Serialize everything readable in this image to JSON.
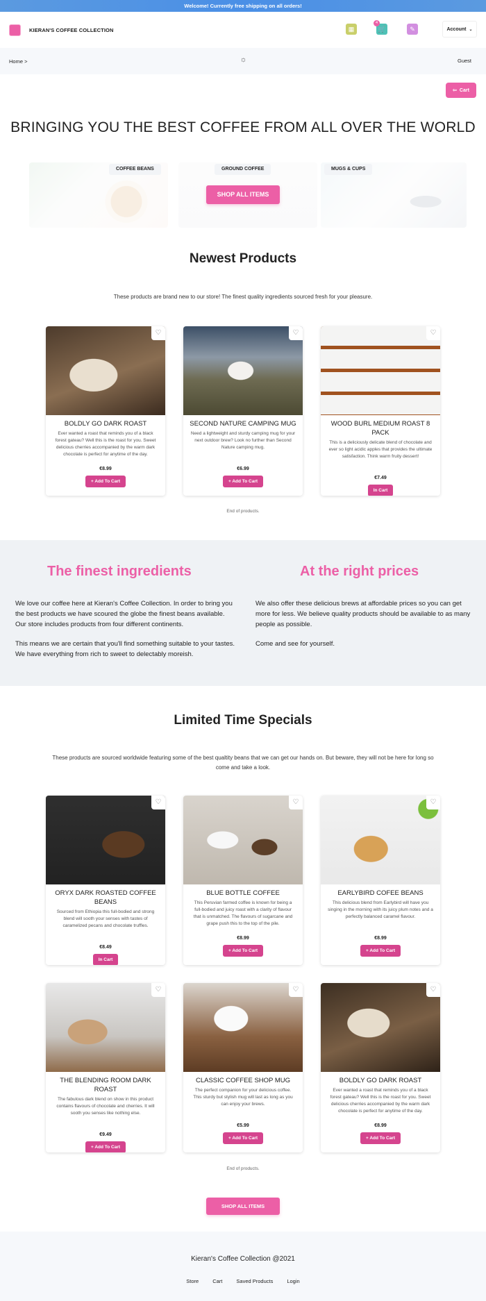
{
  "banner": {
    "text": "Welcome! Currently free shipping on all orders!"
  },
  "header": {
    "brand": "KIERAN'S COFFEE COLLECTION",
    "cart_count": "4",
    "account_label": "Account",
    "colors": {
      "accent": "#ec5fa6",
      "banner": "#4a8fe6"
    }
  },
  "crumbs": {
    "breadcrumb": "Home >",
    "user": "Guest"
  },
  "cart_button": {
    "label": "Cart"
  },
  "hero": {
    "title": "BRINGING YOU THE BEST COFFEE FROM ALL OVER THE WORLD",
    "categories": [
      "COFFEE BEANS",
      "GROUND COFFEE",
      "MUGS & CUPS"
    ],
    "shop_all": "SHOP ALL ITEMS"
  },
  "newest": {
    "title": "Newest Products",
    "subtitle": "These products are brand new to our store! The finest quality ingredients sourced fresh for your pleasure.",
    "products": [
      {
        "name": "BOLDLY GO DARK ROAST",
        "desc": "Ever wanted a roast that reminds you of a black forest gateau? Well this is the roast for you. Sweet delicious cherries accompanied by the warm dark chocolate is perfect for anytime of the day.",
        "price": "€8.99",
        "action": "+ Add To Cart"
      },
      {
        "name": "SECOND NATURE CAMPING MUG",
        "desc": "Need a lightweight and sturdy camping mug for your next outdoor brew? Look no further than Second Nature camping mug.",
        "price": "€6.99",
        "action": "+ Add To Cart"
      },
      {
        "name": "WOOD BURL MEDIUM ROAST 8 PACK",
        "desc": "This is a deliciously delicate blend of chocolate and ever so light acidic apples that provides the ultimate satisfaction. Think warm fruity dessert!",
        "price": "€7.49",
        "action": "In Cart"
      }
    ],
    "end": "End of products."
  },
  "info": {
    "left_title": "The finest ingredients",
    "left_p1": "We love our coffee here at Kieran's Coffee Collection. In order to bring you the best products we have scoured the globe the finest beans available. Our store includes products from four different continents.",
    "left_p2": "This means we are certain that you'll find something suitable to your tastes. We have everything from rich to sweet to delectably moreish.",
    "right_title": "At the right prices",
    "right_p1": "We also offer these delicious brews at affordable prices so you can get more for less. We believe quality products should be available to as many people as possible.",
    "right_p2": "Come and see for yourself."
  },
  "specials": {
    "title": "Limited Time Specials",
    "subtitle": "These products are sourced worldwide featuring some of the best qualtity beans that we can get our hands on. But beware, they will not be here for long so come and take a look.",
    "products": [
      {
        "name": "ORYX DARK ROASTED COFFEE BEANS",
        "desc": "Sourced from Ethiopia this full-bodied and strong blend will sooth your senses with tastes of caramelized pecans and chocolate truffles.",
        "price": "€8.49",
        "action": "In Cart"
      },
      {
        "name": "BLUE BOTTLE COFFEE",
        "desc": "This Peruvian farmed coffee is known for being a full-bodied and juicy roast with a clarity of flavour that is unmatched. The flavours of sugarcane and grape push this to the top of the pile.",
        "price": "€8.99",
        "action": "+ Add To Cart"
      },
      {
        "name": "EARLYBIRD COFEE BEANS",
        "desc": "This delicious blend from Earlybird will have you singing in the morning with its juicy plum notes and a perfectly balanced caramel flavour.",
        "price": "€8.99",
        "action": "+ Add To Cart"
      },
      {
        "name": "THE BLENDING ROOM DARK ROAST",
        "desc": "The fabulous dark blend on show in this product contains flavours of chocolate and cherries. It will sooth you senses like nothing else.",
        "price": "€9.49",
        "action": "+ Add To Cart"
      },
      {
        "name": "CLASSIC COFFEE SHOP MUG",
        "desc": "The perfect companion for your delicious coffee. This sturdy but stylish mug will last as long as you can enjoy your brews.",
        "price": "€5.99",
        "action": "+ Add To Cart"
      },
      {
        "name": "BOLDLY GO DARK ROAST",
        "desc": "Ever wanted a roast that reminds you of a black forest gateau? Well this is the roast for you. Sweet delicious cherries accompanied by the warm dark chocolate is perfect for anytime of the day.",
        "price": "€8.99",
        "action": "+ Add To Cart"
      }
    ],
    "end": "End of products.",
    "shop_all": "SHOP ALL ITEMS"
  },
  "footer": {
    "copyright": "Kieran's Coffee Collection @2021",
    "links": [
      "Store",
      "Cart",
      "Saved Products",
      "Login"
    ]
  }
}
